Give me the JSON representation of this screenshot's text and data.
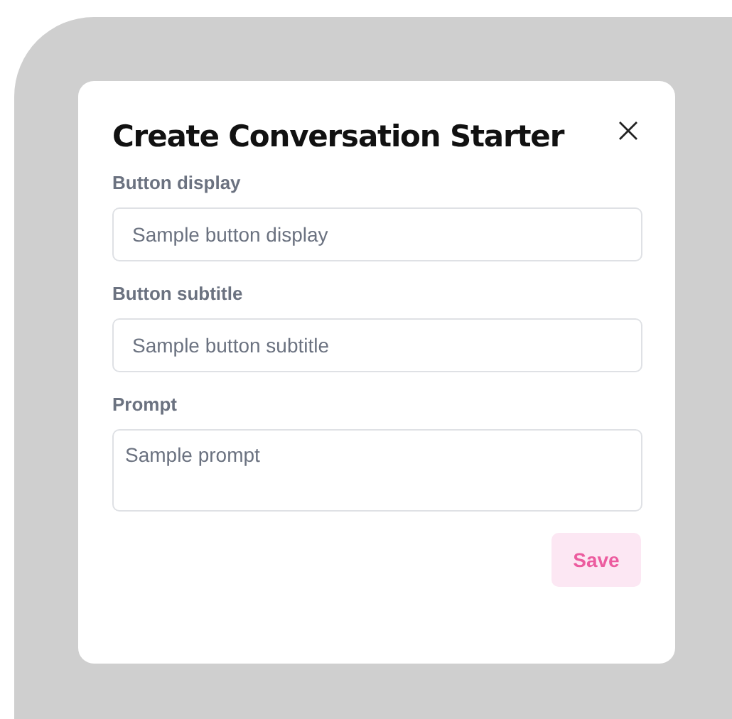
{
  "dialog": {
    "title": "Create Conversation Starter",
    "fields": [
      {
        "label": "Button display",
        "kind": "input",
        "placeholder": "Sample button display"
      },
      {
        "label": "Button subtitle",
        "kind": "input",
        "placeholder": "Sample button subtitle"
      },
      {
        "label": "Prompt",
        "kind": "textarea",
        "placeholder": "Sample prompt"
      }
    ],
    "save_button": {
      "label": "Save",
      "disabled": true
    }
  }
}
